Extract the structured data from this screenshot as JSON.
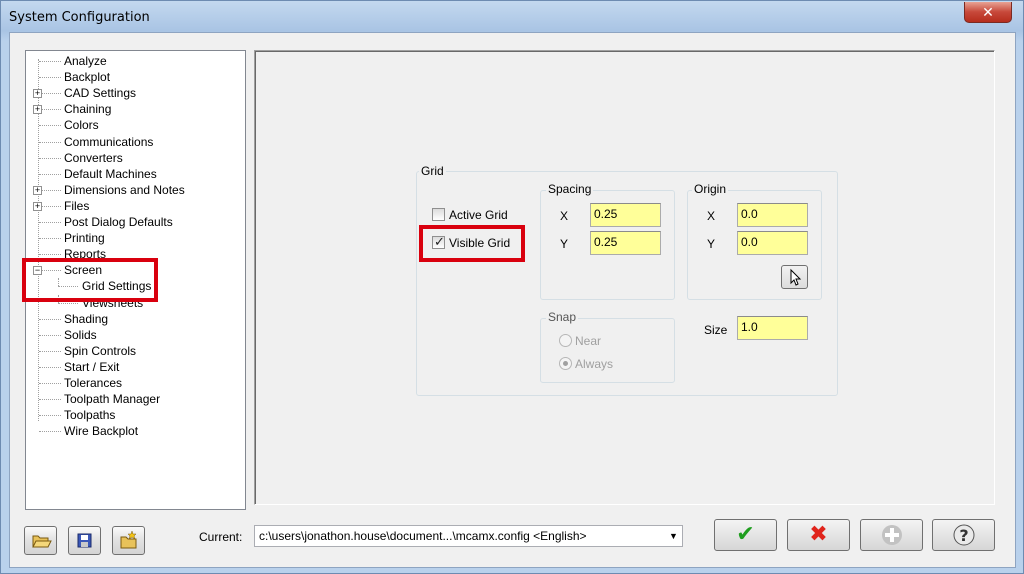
{
  "window": {
    "title": "System Configuration",
    "close_glyph": "✕"
  },
  "tree": {
    "items": [
      {
        "label": "Analyze",
        "level": 0,
        "expandable": false
      },
      {
        "label": "Backplot",
        "level": 0,
        "expandable": false
      },
      {
        "label": "CAD Settings",
        "level": 0,
        "expandable": true,
        "expander": "+"
      },
      {
        "label": "Chaining",
        "level": 0,
        "expandable": true,
        "expander": "+"
      },
      {
        "label": "Colors",
        "level": 0,
        "expandable": false
      },
      {
        "label": "Communications",
        "level": 0,
        "expandable": false
      },
      {
        "label": "Converters",
        "level": 0,
        "expandable": false
      },
      {
        "label": "Default Machines",
        "level": 0,
        "expandable": false
      },
      {
        "label": "Dimensions and Notes",
        "level": 0,
        "expandable": true,
        "expander": "+"
      },
      {
        "label": "Files",
        "level": 0,
        "expandable": true,
        "expander": "+"
      },
      {
        "label": "Post Dialog Defaults",
        "level": 0,
        "expandable": false
      },
      {
        "label": "Printing",
        "level": 0,
        "expandable": false
      },
      {
        "label": "Reports",
        "level": 0,
        "expandable": false
      },
      {
        "label": "Screen",
        "level": 0,
        "expandable": true,
        "expander": "−"
      },
      {
        "label": "Grid Settings",
        "level": 1,
        "selected": true
      },
      {
        "label": "Viewsheets",
        "level": 1
      },
      {
        "label": "Shading",
        "level": 0,
        "expandable": false
      },
      {
        "label": "Solids",
        "level": 0,
        "expandable": false
      },
      {
        "label": "Spin Controls",
        "level": 0,
        "expandable": false
      },
      {
        "label": "Start / Exit",
        "level": 0,
        "expandable": false
      },
      {
        "label": "Tolerances",
        "level": 0,
        "expandable": false
      },
      {
        "label": "Toolpath Manager",
        "level": 0,
        "expandable": false
      },
      {
        "label": "Toolpaths",
        "level": 0,
        "expandable": false
      },
      {
        "label": "Wire Backplot",
        "level": 0,
        "expandable": false
      }
    ]
  },
  "grid": {
    "legend": "Grid",
    "active_grid_label": "Active Grid",
    "active_grid_checked": false,
    "visible_grid_label": "Visible Grid",
    "visible_grid_checked": true,
    "spacing": {
      "legend": "Spacing",
      "x_label": "X",
      "x_value": "0.25",
      "y_label": "Y",
      "y_value": "0.25"
    },
    "origin": {
      "legend": "Origin",
      "x_label": "X",
      "x_value": "0.0",
      "y_label": "Y",
      "y_value": "0.0",
      "select_icon": "pointer-icon"
    },
    "snap": {
      "legend": "Snap",
      "near_label": "Near",
      "always_label": "Always",
      "selected": "Always"
    },
    "size_label": "Size",
    "size_value": "1.0"
  },
  "bottom": {
    "current_label": "Current:",
    "current_value": "c:\\users\\jonathon.house\\document...\\mcamx.config <English>",
    "ok_glyph": "✔",
    "cancel_glyph": "✖",
    "apply_glyph": "✚",
    "help_glyph": "?"
  },
  "colors": {
    "highlight_red": "#d9000e",
    "input_yellow": "#ffff99",
    "ok_green": "#1f9e1f",
    "cancel_red": "#e0241b"
  }
}
